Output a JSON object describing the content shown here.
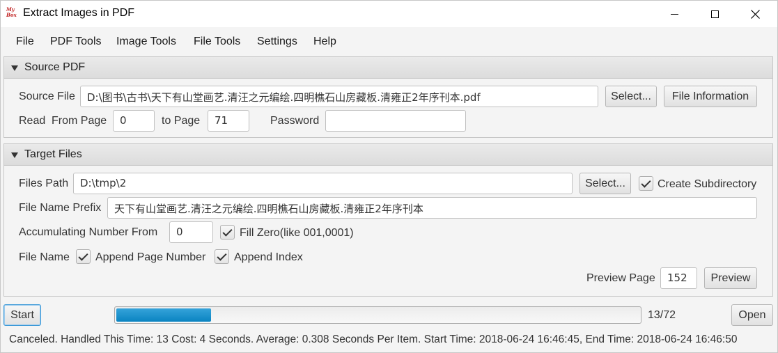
{
  "window": {
    "title": "Extract Images in PDF",
    "app_icon_text": "My Box",
    "minimize_icon": "minimize-icon",
    "maximize_icon": "maximize-icon",
    "close_icon": "close-icon"
  },
  "menu": [
    "File",
    "PDF Tools",
    "Image Tools",
    "File Tools",
    "Settings",
    "Help"
  ],
  "source": {
    "header": "Source PDF",
    "source_file_label": "Source File",
    "source_file_value": "D:\\图书\\古书\\天下有山堂画艺.清汪之元编绘.四明樵石山房藏板.清雍正2年序刊本.pdf",
    "select_button": "Select...",
    "file_info_button": "File Information",
    "read_label": "Read",
    "from_page_label": "From Page",
    "from_page_value": "0",
    "to_page_label": "to Page",
    "to_page_value": "71",
    "password_label": "Password",
    "password_value": ""
  },
  "target": {
    "header": "Target Files",
    "files_path_label": "Files Path",
    "files_path_value": "D:\\tmp\\2",
    "select_button": "Select...",
    "create_subdirectory_label": "Create Subdirectory",
    "create_subdirectory_checked": true,
    "file_name_prefix_label": "File Name Prefix",
    "file_name_prefix_value": "天下有山堂画艺.清汪之元编绘.四明樵石山房藏板.清雍正2年序刊本",
    "accumulating_label": "Accumulating Number From",
    "accumulating_value": "0",
    "fill_zero_label": "Fill Zero(like 001,0001)",
    "fill_zero_checked": true,
    "file_name_label": "File Name",
    "append_page_number_label": "Append Page Number",
    "append_page_number_checked": true,
    "append_index_label": "Append Index",
    "append_index_checked": true,
    "preview_page_label": "Preview Page",
    "preview_page_value": "152",
    "preview_button": "Preview"
  },
  "progress": {
    "start_button": "Start",
    "fraction": 0.1806,
    "count_text": "13/72",
    "open_button": "Open",
    "color": "#0a84c1"
  },
  "status_text": "Canceled. Handled This Time: 13 Cost: 4 Seconds. Average: 0.308 Seconds Per Item. Start Time: 2018-06-24 16:46:45, End Time: 2018-06-24 16:46:50"
}
